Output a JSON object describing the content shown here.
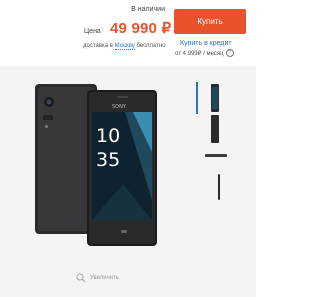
{
  "availability": "В наличии",
  "price_label": "Цена",
  "price": "49 990 ₽",
  "delivery": {
    "prefix": "доставка в",
    "city": "Москву",
    "suffix": "бесплатно"
  },
  "buy_button": "Купить",
  "credit": {
    "link": "Купить в кредит",
    "sub": "от 4 999₽ / месяц"
  },
  "zoom_label": "Увеличить",
  "phone": {
    "clock_hour": "10",
    "clock_minute": "35",
    "brand": "SONY"
  },
  "colors": {
    "accent": "#e8532e",
    "link": "#2a73c5",
    "gallery_bg": "#f4f4f4",
    "thumb_active": "#2a73c5"
  },
  "icons": {
    "help": "question-circle-icon",
    "zoom": "magnifier-icon"
  },
  "thumbnails": {
    "count": 4,
    "active_index": 0
  }
}
